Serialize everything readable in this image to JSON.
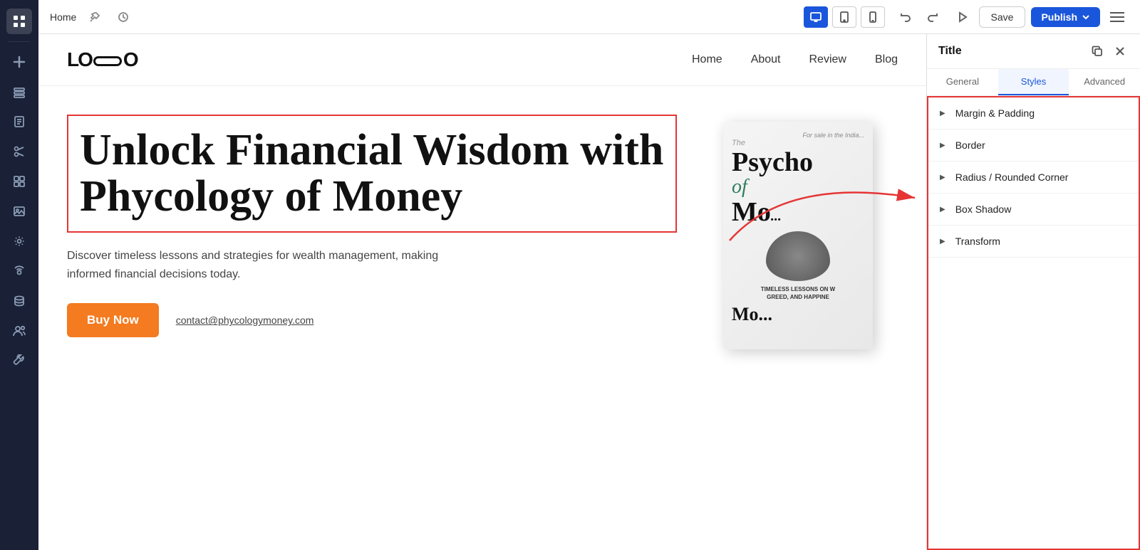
{
  "topbar": {
    "page_name": "Home",
    "save_label": "Save",
    "publish_label": "Publish",
    "viewport": {
      "desktop_label": "desktop",
      "tablet_label": "tablet",
      "mobile_label": "mobile"
    }
  },
  "sidebar": {
    "icons": [
      {
        "name": "grid-icon",
        "symbol": "⊞",
        "active": true
      },
      {
        "name": "plus-icon",
        "symbol": "+"
      },
      {
        "name": "layers-icon",
        "symbol": "⧉"
      },
      {
        "name": "page-icon",
        "symbol": "☐"
      },
      {
        "name": "scissors-icon",
        "symbol": "✂"
      },
      {
        "name": "components-icon",
        "symbol": "⊞"
      },
      {
        "name": "image-icon",
        "symbol": "🖼"
      },
      {
        "name": "settings-icon",
        "symbol": "⚙"
      },
      {
        "name": "broadcast-icon",
        "symbol": "📡"
      },
      {
        "name": "database-icon",
        "symbol": "🗄"
      },
      {
        "name": "users-icon",
        "symbol": "👥"
      },
      {
        "name": "tools-icon",
        "symbol": "🔧"
      }
    ]
  },
  "site": {
    "nav": {
      "logo": "LOGO",
      "links": [
        "Home",
        "About",
        "Review",
        "Blog"
      ]
    },
    "hero": {
      "title": "Unlock Financial Wisdom with Phycology of Money",
      "subtitle": "Discover timeless lessons and strategies for wealth management, making informed financial decisions today.",
      "buy_button": "Buy Now",
      "contact_link": "contact@phycologymoney.com"
    },
    "book": {
      "sale_text": "For sale in the India...",
      "title_t": "Th",
      "title_psycho": "Psycho",
      "title_of": "of",
      "title_mo": "Mo",
      "bottom_text": "TIMELESS LESSONS ON W GREED, AND HAPPINE",
      "bottom_text2": "Mo..."
    }
  },
  "right_panel": {
    "title": "Title",
    "tabs": [
      {
        "id": "general",
        "label": "General"
      },
      {
        "id": "styles",
        "label": "Styles"
      },
      {
        "id": "advanced",
        "label": "Advanced"
      }
    ],
    "sections": [
      {
        "id": "margin-padding",
        "label": "Margin & Padding"
      },
      {
        "id": "border",
        "label": "Border"
      },
      {
        "id": "radius-rounded",
        "label": "Radius / Rounded Corner"
      },
      {
        "id": "box-shadow",
        "label": "Box Shadow"
      },
      {
        "id": "transform",
        "label": "Transform"
      }
    ]
  },
  "colors": {
    "brand_blue": "#1a56db",
    "accent_orange": "#f47b20",
    "accent_red": "#e53535",
    "sidebar_bg": "#1a2035",
    "text_dark": "#111111"
  }
}
